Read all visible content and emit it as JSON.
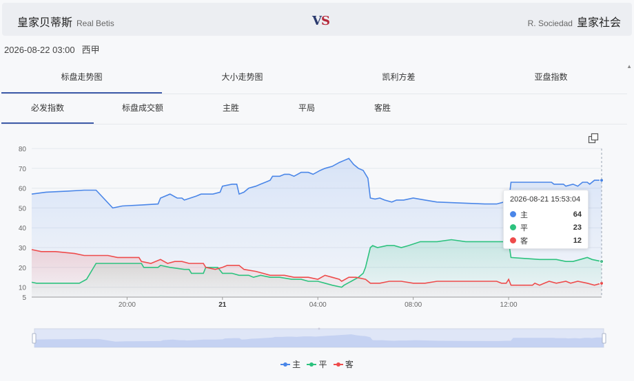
{
  "header": {
    "home_cn": "皇家贝蒂斯",
    "home_en": "Real Betis",
    "vs_v": "V",
    "vs_s": "S",
    "away_en": "R. Sociedad",
    "away_cn": "皇家社会"
  },
  "match": {
    "datetime": "2026-08-22 03:00",
    "league": "西甲"
  },
  "tabs_primary": [
    "标盘走势图",
    "大小走势图",
    "凯利方差",
    "亚盘指数"
  ],
  "tabs_secondary": [
    "必发指数",
    "标盘成交额",
    "主胜",
    "平局",
    "客胜"
  ],
  "tooltip": {
    "time": "2026-08-21 15:53:04",
    "rows": [
      {
        "name": "主",
        "value": "64"
      },
      {
        "name": "平",
        "value": "23"
      },
      {
        "name": "客",
        "value": "12"
      }
    ]
  },
  "legend": [
    "主",
    "平",
    "客"
  ],
  "colors": {
    "home": "#4a86e8",
    "draw": "#2cc27e",
    "away": "#ee4b4b",
    "tab_active": "#3d5aa8"
  },
  "icons": {
    "toolbox": "restore-icon",
    "scroll": "caret-up-icon"
  },
  "chart_data": {
    "type": "line",
    "x_unit": "hours since 2026-08-20 16:00",
    "x_ticks": [
      {
        "x": 4,
        "label": "20:00",
        "bold": false
      },
      {
        "x": 8,
        "label": "21",
        "bold": true
      },
      {
        "x": 12,
        "label": "04:00",
        "bold": false
      },
      {
        "x": 16,
        "label": "08:00",
        "bold": false
      },
      {
        "x": 20,
        "label": "12:00",
        "bold": false
      }
    ],
    "xlim": [
      0,
      23.9
    ],
    "ylim": [
      5,
      80
    ],
    "y_ticks": [
      5,
      10,
      20,
      30,
      40,
      50,
      60,
      70,
      80
    ],
    "grid": true,
    "legend_position": "bottom-center",
    "series": [
      {
        "name": "主",
        "points": [
          [
            0,
            57
          ],
          [
            0.6,
            58
          ],
          [
            1.5,
            58.5
          ],
          [
            2.2,
            59
          ],
          [
            2.7,
            59
          ],
          [
            3.4,
            50
          ],
          [
            3.8,
            51
          ],
          [
            4.6,
            51.5
          ],
          [
            5.3,
            52
          ],
          [
            5.4,
            55
          ],
          [
            5.8,
            57
          ],
          [
            6.1,
            55
          ],
          [
            6.3,
            55
          ],
          [
            6.4,
            54
          ],
          [
            6.9,
            56
          ],
          [
            7.1,
            57
          ],
          [
            7.6,
            57
          ],
          [
            7.9,
            58
          ],
          [
            8.0,
            61
          ],
          [
            8.4,
            62
          ],
          [
            8.6,
            62
          ],
          [
            8.7,
            57
          ],
          [
            8.9,
            58
          ],
          [
            9.1,
            60
          ],
          [
            9.4,
            61
          ],
          [
            9.6,
            62
          ],
          [
            9.8,
            63
          ],
          [
            10.0,
            64
          ],
          [
            10.1,
            66
          ],
          [
            10.4,
            66
          ],
          [
            10.6,
            67
          ],
          [
            10.8,
            67
          ],
          [
            11.0,
            66
          ],
          [
            11.3,
            68
          ],
          [
            11.6,
            68
          ],
          [
            11.8,
            67
          ],
          [
            12.1,
            69
          ],
          [
            12.3,
            70
          ],
          [
            12.6,
            71
          ],
          [
            12.9,
            73
          ],
          [
            13.1,
            74
          ],
          [
            13.3,
            75
          ],
          [
            13.5,
            72
          ],
          [
            13.7,
            70
          ],
          [
            13.9,
            69
          ],
          [
            14.1,
            65
          ],
          [
            14.2,
            55
          ],
          [
            14.4,
            54.5
          ],
          [
            14.6,
            55
          ],
          [
            14.8,
            54
          ],
          [
            15.1,
            53
          ],
          [
            15.3,
            54
          ],
          [
            15.6,
            54
          ],
          [
            16.0,
            55
          ],
          [
            16.5,
            54
          ],
          [
            17.0,
            53
          ],
          [
            18.0,
            52.5
          ],
          [
            19.0,
            52
          ],
          [
            19.5,
            52
          ],
          [
            19.8,
            53
          ],
          [
            20.0,
            53
          ],
          [
            20.1,
            63
          ],
          [
            21.8,
            63
          ],
          [
            21.9,
            62
          ],
          [
            22.3,
            62
          ],
          [
            22.4,
            61
          ],
          [
            22.7,
            62
          ],
          [
            22.9,
            61
          ],
          [
            23.1,
            63
          ],
          [
            23.3,
            63
          ],
          [
            23.4,
            62
          ],
          [
            23.6,
            64
          ],
          [
            23.9,
            64
          ]
        ]
      },
      {
        "name": "平",
        "points": [
          [
            0,
            12.5
          ],
          [
            0.2,
            12
          ],
          [
            2.0,
            12
          ],
          [
            2.3,
            14
          ],
          [
            2.7,
            22
          ],
          [
            3.3,
            22
          ],
          [
            4.0,
            22
          ],
          [
            4.6,
            22
          ],
          [
            4.7,
            20
          ],
          [
            5.3,
            20
          ],
          [
            5.4,
            21
          ],
          [
            5.8,
            20
          ],
          [
            6.4,
            19
          ],
          [
            6.6,
            19
          ],
          [
            6.7,
            17
          ],
          [
            7.2,
            17
          ],
          [
            7.3,
            20
          ],
          [
            7.8,
            20
          ],
          [
            8.0,
            17
          ],
          [
            8.4,
            17
          ],
          [
            8.7,
            16
          ],
          [
            9.1,
            16
          ],
          [
            9.3,
            15
          ],
          [
            9.6,
            16
          ],
          [
            10.0,
            15
          ],
          [
            10.4,
            15
          ],
          [
            10.9,
            14
          ],
          [
            11.3,
            14
          ],
          [
            11.6,
            13
          ],
          [
            12.0,
            13
          ],
          [
            12.3,
            12
          ],
          [
            12.6,
            11
          ],
          [
            13.0,
            10
          ],
          [
            13.1,
            11
          ],
          [
            13.4,
            13
          ],
          [
            13.7,
            15
          ],
          [
            13.9,
            17
          ],
          [
            14.0,
            20
          ],
          [
            14.2,
            30
          ],
          [
            14.3,
            31
          ],
          [
            14.5,
            30
          ],
          [
            14.9,
            31
          ],
          [
            15.2,
            31
          ],
          [
            15.5,
            30
          ],
          [
            15.8,
            31
          ],
          [
            16.3,
            33
          ],
          [
            17.0,
            33
          ],
          [
            17.6,
            34
          ],
          [
            18.2,
            33
          ],
          [
            19.0,
            33
          ],
          [
            20.0,
            33
          ],
          [
            20.1,
            25
          ],
          [
            21.3,
            24
          ],
          [
            22.0,
            24
          ],
          [
            22.4,
            23
          ],
          [
            22.7,
            23
          ],
          [
            23.0,
            24
          ],
          [
            23.3,
            25
          ],
          [
            23.5,
            24
          ],
          [
            23.9,
            23
          ]
        ]
      },
      {
        "name": "客",
        "points": [
          [
            0,
            29
          ],
          [
            0.4,
            28
          ],
          [
            1.0,
            28
          ],
          [
            1.8,
            27
          ],
          [
            2.2,
            26
          ],
          [
            3.2,
            26
          ],
          [
            3.6,
            25
          ],
          [
            4.5,
            25
          ],
          [
            4.6,
            23
          ],
          [
            5.0,
            22
          ],
          [
            5.4,
            24
          ],
          [
            5.7,
            22
          ],
          [
            6.0,
            23
          ],
          [
            6.3,
            23
          ],
          [
            6.6,
            22
          ],
          [
            7.2,
            22
          ],
          [
            7.3,
            20
          ],
          [
            7.7,
            19
          ],
          [
            8.0,
            20
          ],
          [
            8.2,
            21
          ],
          [
            8.7,
            21
          ],
          [
            8.9,
            19
          ],
          [
            9.4,
            18
          ],
          [
            9.7,
            17
          ],
          [
            10.0,
            16
          ],
          [
            10.2,
            16
          ],
          [
            10.6,
            16
          ],
          [
            11.0,
            15
          ],
          [
            11.3,
            15
          ],
          [
            11.6,
            15
          ],
          [
            12.0,
            14
          ],
          [
            12.3,
            16
          ],
          [
            12.6,
            15
          ],
          [
            12.9,
            14
          ],
          [
            13.0,
            13
          ],
          [
            13.3,
            15
          ],
          [
            13.6,
            15
          ],
          [
            14.0,
            14
          ],
          [
            14.2,
            12
          ],
          [
            14.6,
            12
          ],
          [
            15.0,
            13
          ],
          [
            15.5,
            13
          ],
          [
            16.0,
            12
          ],
          [
            16.5,
            12
          ],
          [
            17.0,
            13
          ],
          [
            18.0,
            13
          ],
          [
            19.5,
            13
          ],
          [
            19.7,
            12
          ],
          [
            19.9,
            12
          ],
          [
            20.0,
            14
          ],
          [
            20.1,
            11
          ],
          [
            21.0,
            11
          ],
          [
            21.1,
            12
          ],
          [
            21.3,
            11
          ],
          [
            21.5,
            12
          ],
          [
            21.7,
            13
          ],
          [
            22.0,
            12
          ],
          [
            22.4,
            13
          ],
          [
            22.6,
            12
          ],
          [
            22.9,
            13
          ],
          [
            23.3,
            12
          ],
          [
            23.6,
            11
          ],
          [
            23.9,
            12
          ]
        ]
      }
    ]
  }
}
